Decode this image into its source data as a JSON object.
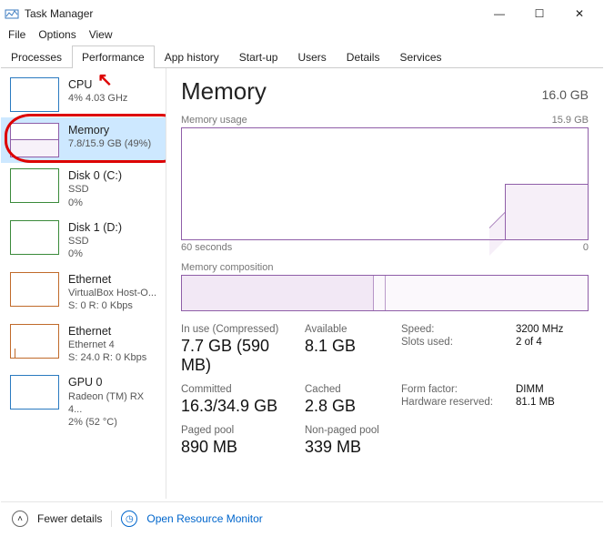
{
  "window": {
    "title": "Task Manager"
  },
  "menu": {
    "file": "File",
    "options": "Options",
    "view": "View"
  },
  "tabs": {
    "processes": "Processes",
    "performance": "Performance",
    "app_history": "App history",
    "startup": "Start-up",
    "users": "Users",
    "details": "Details",
    "services": "Services"
  },
  "sidebar": [
    {
      "name": "CPU",
      "sub1": "4% 4.03 GHz",
      "sub2": ""
    },
    {
      "name": "Memory",
      "sub1": "7.8/15.9 GB (49%)",
      "sub2": ""
    },
    {
      "name": "Disk 0 (C:)",
      "sub1": "SSD",
      "sub2": "0%"
    },
    {
      "name": "Disk 1 (D:)",
      "sub1": "SSD",
      "sub2": "0%"
    },
    {
      "name": "Ethernet",
      "sub1": "VirtualBox Host-O...",
      "sub2": "S: 0 R: 0 Kbps"
    },
    {
      "name": "Ethernet",
      "sub1": "Ethernet 4",
      "sub2": "S: 24.0 R: 0 Kbps"
    },
    {
      "name": "GPU 0",
      "sub1": "Radeon (TM) RX 4...",
      "sub2": "2% (52 °C)"
    }
  ],
  "main": {
    "title": "Memory",
    "capacity": "16.0 GB",
    "usage_label": "Memory usage",
    "usage_max": "15.9 GB",
    "axis_left": "60 seconds",
    "axis_right": "0",
    "comp_label": "Memory composition",
    "stats": {
      "in_use_label": "In use (Compressed)",
      "in_use": "7.7 GB (590 MB)",
      "available_label": "Available",
      "available": "8.1 GB",
      "committed_label": "Committed",
      "committed": "16.3/34.9 GB",
      "cached_label": "Cached",
      "cached": "2.8 GB",
      "paged_label": "Paged pool",
      "paged": "890 MB",
      "nonpaged_label": "Non-paged pool",
      "nonpaged": "339 MB",
      "speed_label": "Speed:",
      "speed": "3200 MHz",
      "slots_label": "Slots used:",
      "slots": "2 of 4",
      "form_label": "Form factor:",
      "form": "DIMM",
      "hw_label": "Hardware reserved:",
      "hw": "81.1 MB"
    }
  },
  "footer": {
    "fewer": "Fewer details",
    "resmon": "Open Resource Monitor"
  },
  "colors": {
    "accent_purple": "#8f5ea8",
    "selection_blue": "#cde8ff",
    "annotation_red": "#d00"
  }
}
